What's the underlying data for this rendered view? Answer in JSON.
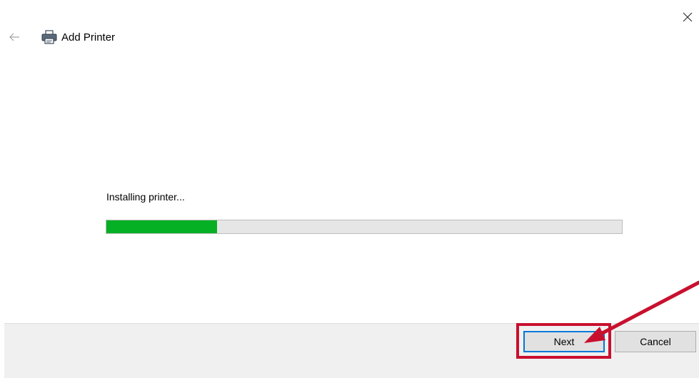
{
  "window": {
    "title": "Add Printer",
    "close_icon": "close-icon",
    "back_icon": "back-arrow-icon",
    "printer_icon": "printer-icon"
  },
  "main": {
    "status_text": "Installing printer...",
    "progress_fraction": 0.215
  },
  "footer": {
    "next_label": "Next",
    "cancel_label": "Cancel"
  },
  "annotation": {
    "highlight_color": "#c8102e",
    "target": "Next"
  },
  "colors": {
    "progress_fill": "#06b025",
    "progress_track": "#e6e6e6",
    "focus_border": "#0078d7",
    "footer_bg": "#f0f0f0"
  }
}
